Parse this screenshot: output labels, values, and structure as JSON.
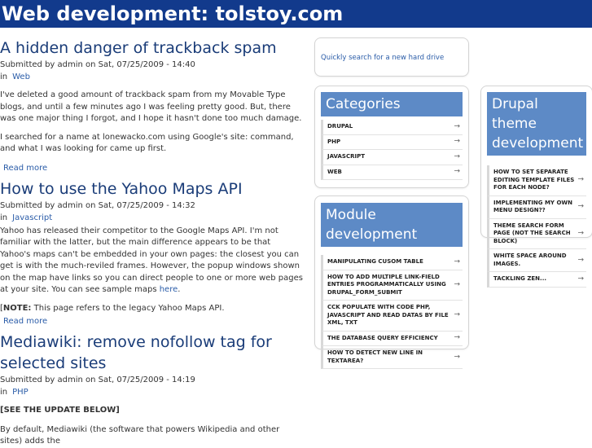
{
  "site": {
    "title": "Web development: tolstoy.com"
  },
  "nodes": [
    {
      "title": "A hidden danger of trackback spam",
      "meta": "Submitted by admin on Sat, 07/25/2009 - 14:40",
      "in_label": "in",
      "term": "Web",
      "paragraphs": [
        "I've deleted a good amount of trackback spam from my Movable Type blogs, and until a few minutes ago I was feeling pretty good. But, there was one major thing I forgot, and I hope it hasn't done too much damage.",
        "I searched for a name at lonewacko.com using Google's site: command, and what I was looking for came up first."
      ],
      "readmore": "Read more"
    },
    {
      "title": "How to use the Yahoo Maps API",
      "meta": "Submitted by admin on Sat, 07/25/2009 - 14:32",
      "in_label": "in",
      "term": "Javascript",
      "paragraph": "Yahoo has released their competitor to the Google Maps API. I'm not familiar with the latter, but the main difference appears to be that Yahoo's maps can't be embedded in your own pages: the closest you can get is with the much-reviled frames. However, the popup windows shown on the map have links so you can direct people to one or more web pages at your site. You can see sample maps",
      "here_link": "here",
      "period": ".",
      "note_open": "[",
      "note_label": "NOTE:",
      "note_text": " This page refers to the legacy Yahoo Maps API.",
      "readmore": "Read more"
    },
    {
      "title": "Mediawiki: remove nofollow tag for selected sites",
      "meta": "Submitted by admin on Sat, 07/25/2009 - 14:19",
      "in_label": "in",
      "term": "PHP",
      "update": "[SEE THE UPDATE BELOW]",
      "paragraph": "By default, Mediawiki (the software that powers Wikipedia and other sites) adds the"
    }
  ],
  "search": {
    "link_text": "Quickly search for a new hard drive"
  },
  "categories": {
    "title": "Categories",
    "items": [
      "DRUPAL",
      "PHP",
      "JAVASCRIPT",
      "WEB"
    ]
  },
  "drupal_theme": {
    "title": "Drupal theme development",
    "items": [
      "HOW TO SET SEPARATE EDITING TEMPLATE FILES FOR EACH NODE?",
      "IMPLEMENTING MY OWN MENU DESIGN??",
      "THEME SEARCH FORM PAGE (NOT THE SEARCH BLOCK)",
      "WHITE SPACE AROUND IMAGES.",
      "TACKLING ZEN..."
    ]
  },
  "module_dev": {
    "title": "Module development",
    "items": [
      "MANIPULATING CUSOM TABLE",
      "HOW TO ADD MULTIPLE LINK-FIELD ENTRIES PROGRAMMATICALLY USING DRUPAL_FORM_SUBMIT",
      "CCK POPULATE WITH CODE PHP, JAVASCRIPT AND READ DATAS BY FILE XML, TXT",
      "THE DATABASE QUERY EFFICIENCY",
      "HOW TO DETECT NEW LINE IN TEXTAREA?"
    ]
  },
  "icons": {
    "menu_arrow": "arrow-right-icon"
  },
  "colors": {
    "header_bg": "#123a8c",
    "block_title_bg": "#5d8ac6",
    "link": "#2a5ca8",
    "title": "#1a3c78"
  }
}
